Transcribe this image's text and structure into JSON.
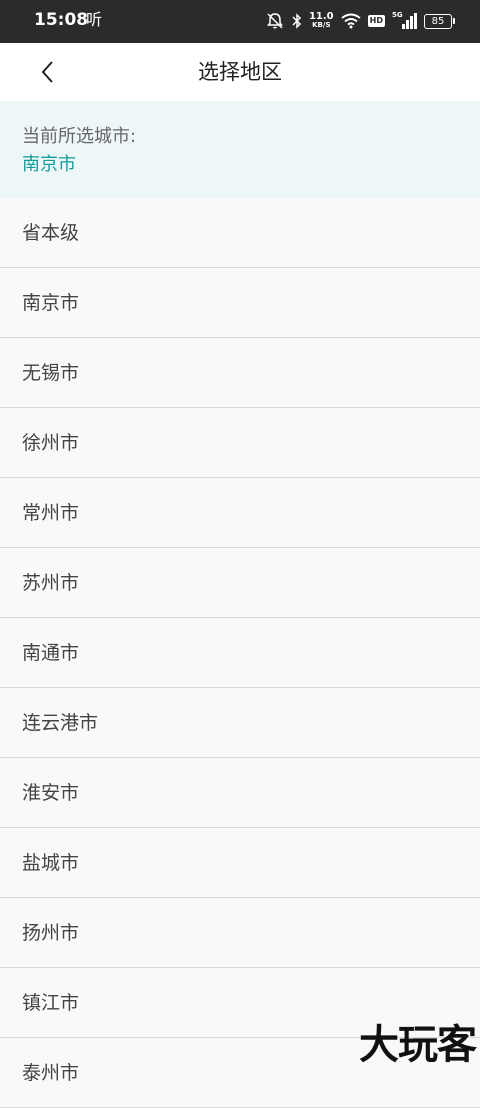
{
  "status_bar": {
    "time": "15:08",
    "app_label": "听",
    "speed_value": "11.0",
    "speed_unit": "KB/S",
    "hd_label": "HD",
    "network_label": "5G",
    "battery": "85",
    "icons": [
      "mute-bell-icon",
      "bluetooth-icon",
      "wifi-icon",
      "signal-icon",
      "battery-icon"
    ]
  },
  "header": {
    "title": "选择地区",
    "back_icon": "chevron-left-icon"
  },
  "current": {
    "label": "当前所选城市:",
    "city": "南京市"
  },
  "cities": [
    "省本级",
    "南京市",
    "无锡市",
    "徐州市",
    "常州市",
    "苏州市",
    "南通市",
    "连云港市",
    "淮安市",
    "盐城市",
    "扬州市",
    "镇江市",
    "泰州市"
  ],
  "watermark": "大玩客",
  "colors": {
    "accent": "#159b9b",
    "status_bar": "#2b2b2b",
    "current_bg": "#eef7f8"
  }
}
